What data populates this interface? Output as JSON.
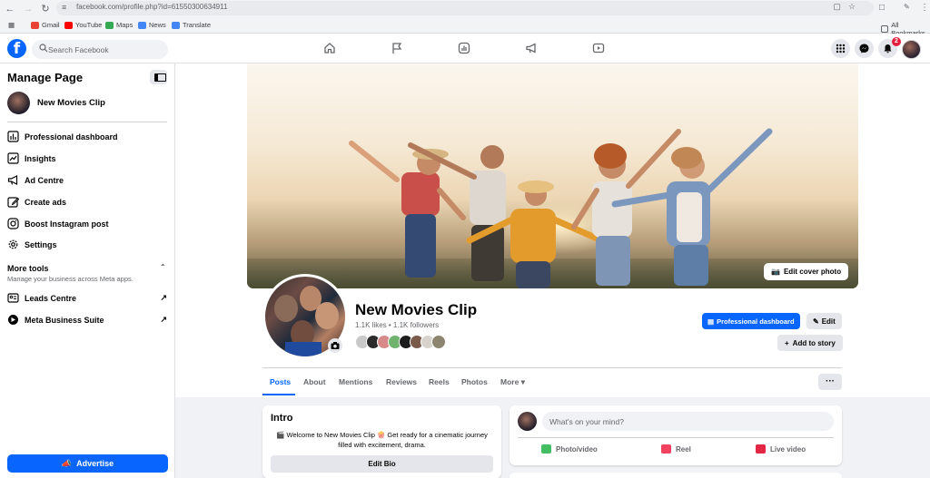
{
  "browser": {
    "url": "facebook.com/profile.php?id=61550300634911",
    "bookmarks": [
      {
        "label": "Gmail",
        "color": "#ea4335"
      },
      {
        "label": "YouTube",
        "color": "#ff0000"
      },
      {
        "label": "Maps",
        "color": "#34a853"
      },
      {
        "label": "News",
        "color": "#4285f4"
      },
      {
        "label": "Translate",
        "color": "#4285f4"
      }
    ],
    "all_bookmarks": "All Bookmarks"
  },
  "topbar": {
    "logo": "f",
    "search_placeholder": "Search Facebook",
    "nav_icons": [
      "home-icon",
      "flag-icon",
      "chart-icon",
      "megaphone-icon",
      "video-icon"
    ],
    "notification_count": "2",
    "brand_color": "#0866ff"
  },
  "sidebar": {
    "title": "Manage Page",
    "page_name": "New Movies Clip",
    "items": [
      {
        "label": "Professional dashboard",
        "icon": "dashboard-icon"
      },
      {
        "label": "Insights",
        "icon": "insights-icon"
      },
      {
        "label": "Ad Centre",
        "icon": "megaphone-icon"
      },
      {
        "label": "Create ads",
        "icon": "edit-icon"
      },
      {
        "label": "Boost Instagram post",
        "icon": "instagram-icon"
      },
      {
        "label": "Settings",
        "icon": "gear-icon"
      }
    ],
    "more_tools": {
      "title": "More tools",
      "subtitle": "Manage your business across Meta apps.",
      "items": [
        {
          "label": "Leads Centre",
          "icon": "leads-icon"
        },
        {
          "label": "Meta Business Suite",
          "icon": "meta-icon"
        }
      ]
    },
    "advertise_label": "Advertise"
  },
  "profile": {
    "name": "New Movies Clip",
    "stats": "1.1K likes • 1.1K followers",
    "edit_cover_label": "Edit cover photo",
    "professional_dashboard_label": "Professional dashboard",
    "edit_label": "Edit",
    "add_to_story_label": "Add to story",
    "tabs": [
      "Posts",
      "About",
      "Mentions",
      "Reviews",
      "Reels",
      "Photos",
      "More"
    ],
    "active_tab": "Posts",
    "tab_more_dots": "···"
  },
  "intro": {
    "title": "Intro",
    "bio": "🎬 Welcome to New Movies Clip 🍿 Get ready for a cinematic journey filled with excitement, drama.",
    "edit_bio_label": "Edit Bio"
  },
  "composer": {
    "placeholder": "What's on your mind?",
    "actions": [
      {
        "label": "Photo/video",
        "color": "#45bd62"
      },
      {
        "label": "Reel",
        "color": "#f3425f"
      },
      {
        "label": "Live video",
        "color": "#e42645"
      }
    ]
  }
}
